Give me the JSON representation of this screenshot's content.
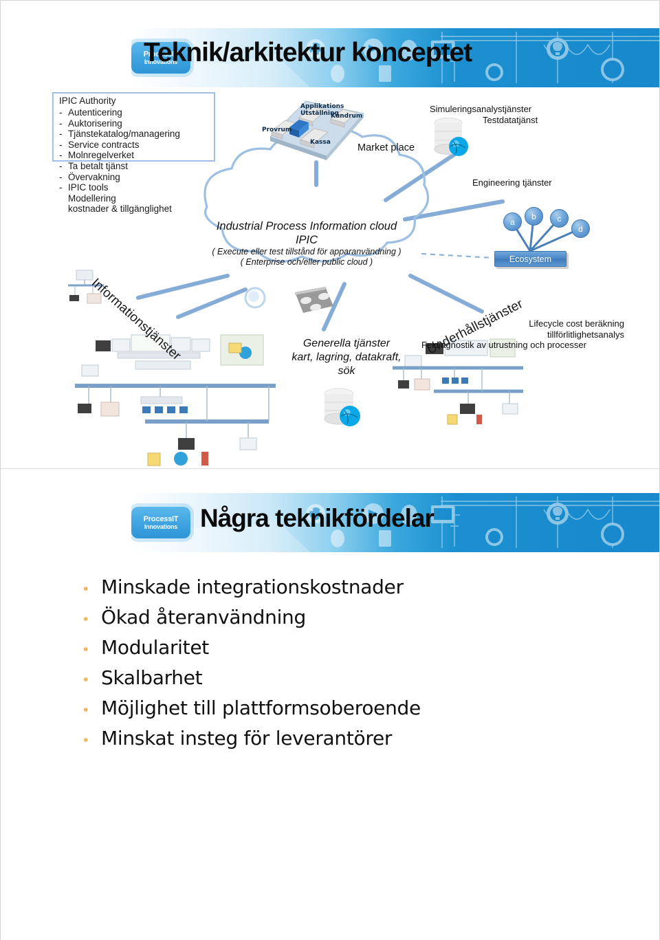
{
  "slide1": {
    "logo": {
      "line1": "ProcessIT",
      "line2": "Innovations"
    },
    "title": "Teknik/arkitektur konceptet",
    "auth_box": {
      "title": "IPIC Authority",
      "items": [
        {
          "dash": "-",
          "text": "Autenticering",
          "sub": false
        },
        {
          "dash": "-",
          "text": "Auktorisering",
          "sub": false
        },
        {
          "dash": "-",
          "text": "Tjänstekatalog/managering",
          "sub": false
        },
        {
          "dash": "-",
          "text": "Service contracts",
          "sub": false
        },
        {
          "dash": "-",
          "text": "Molnregelverket",
          "sub": false
        },
        {
          "dash": "-",
          "text": "Ta betalt tjänst",
          "sub": false
        },
        {
          "dash": "-",
          "text": "Övervakning",
          "sub": false
        },
        {
          "dash": "-",
          "text": "IPIC tools",
          "sub": false
        },
        {
          "dash": "",
          "text": "Modellering",
          "sub": true
        },
        {
          "dash": "",
          "text": "kostnader & tillgänglighet",
          "sub": true
        }
      ]
    },
    "cloud": {
      "line1": "Industrial Process Information cloud",
      "line2": "IPIC",
      "line3": "( Execute eller test tillstånd för apparanvändning )",
      "line4": "( Enterprise och/eller public cloud )"
    },
    "marketplace": {
      "label": "Market place",
      "tiles": [
        "Provrum",
        "Applikations",
        "Utställning",
        "Kundrum",
        "Kassa"
      ]
    },
    "labels": {
      "simulering": "Simuleringsanalystjänster",
      "testdata": "Testdatatjänst",
      "engineering": "Engineering tjänster",
      "ecosystem": "Ecosystem",
      "informationstjanster": "Informationstjänster",
      "underhallstjanster": "Underhållstjänster",
      "generella_l1": "Generella tjänster",
      "generella_l2": "kart, lagring, datakraft,",
      "generella_l3": "sök",
      "lifecycle_l1": "Lifecycle cost beräkning",
      "lifecycle_l2": "tillförlitlighetsanalys",
      "lifecycle_l3": "Feldiagnostik av utrustning och processer"
    },
    "eco_nodes": [
      "a",
      "b",
      "c",
      "d"
    ]
  },
  "slide2": {
    "logo": {
      "line1": "ProcessIT",
      "line2": "Innovations"
    },
    "title": "Några teknikfördelar",
    "bullet_char": "•",
    "bullets": [
      "Minskade integrationskostnader",
      "Ökad återanvändning",
      "Modularitet",
      "Skalbarhet",
      "Möjlighet till plattformsoberoende",
      "Minskat insteg för leverantörer"
    ]
  },
  "colors": {
    "banner_blue": "#1789cc",
    "line_blue": "#7fa8d4",
    "cloud_stroke": "#9dbfe2",
    "bullet_gold": "#f0b860",
    "box_border": "#9fc0e0"
  }
}
